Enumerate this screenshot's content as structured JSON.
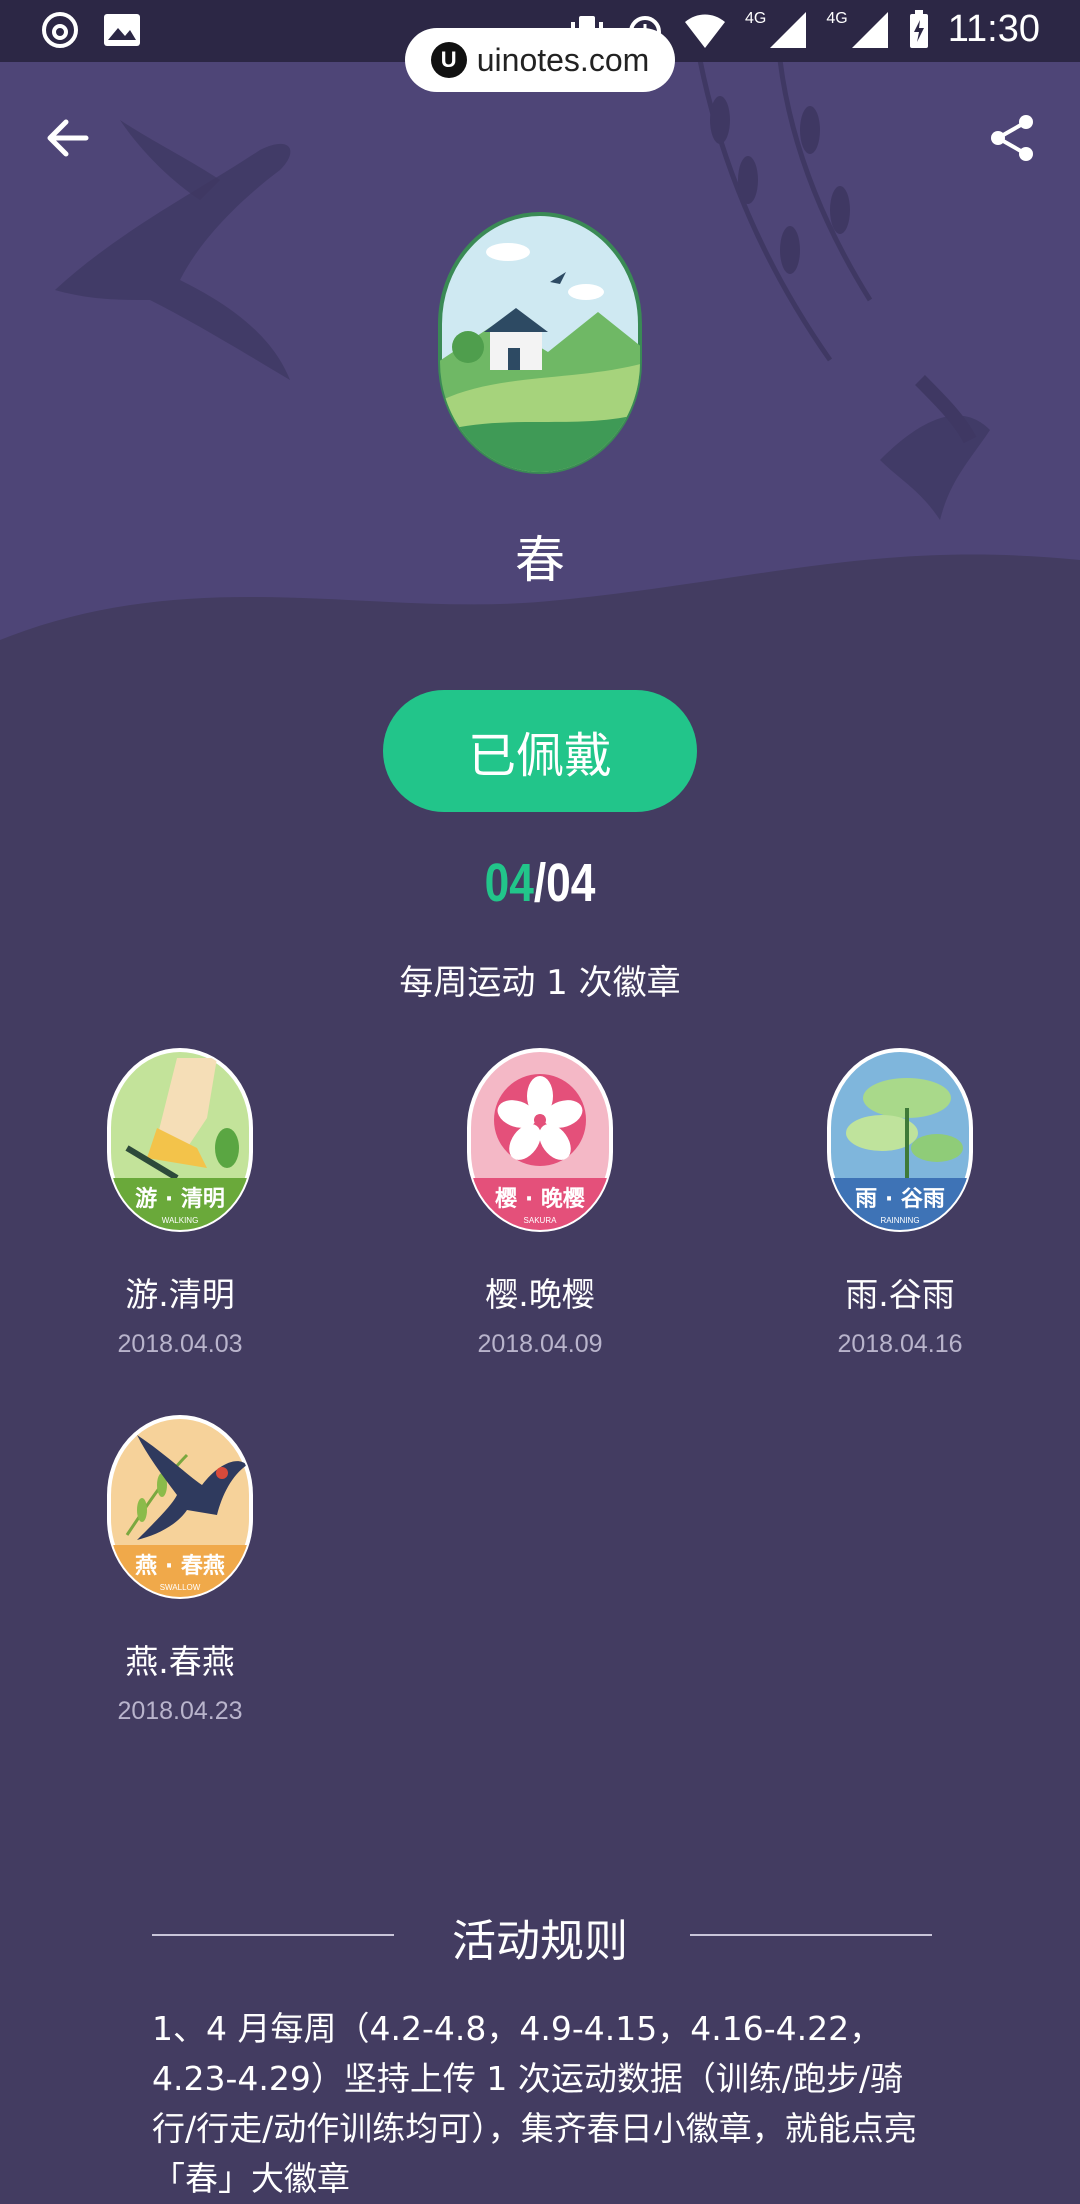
{
  "status_bar": {
    "time": "11:30",
    "network_1": "4G",
    "network_2": "4G"
  },
  "watermark": {
    "text": "uinotes.com",
    "logo": "U"
  },
  "header": {
    "back_icon": "arrow-left-icon",
    "share_icon": "share-icon"
  },
  "badge": {
    "title": "春",
    "status_button": "已佩戴"
  },
  "progress": {
    "current": "04",
    "separator": "/",
    "total": "04"
  },
  "subtitle": "每周运动 1 次徽章",
  "badges": [
    {
      "name": "游.清明",
      "date": "2018.04.03",
      "banner": "游 · 清明",
      "caption": "WALKING",
      "color": "#6aa93a"
    },
    {
      "name": "樱.晚樱",
      "date": "2018.04.09",
      "banner": "樱 · 晚樱",
      "caption": "SAKURA",
      "color": "#e4507a"
    },
    {
      "name": "雨.谷雨",
      "date": "2018.04.16",
      "banner": "雨 · 谷雨",
      "caption": "RAINNING",
      "color": "#3e73b6"
    },
    {
      "name": "燕.春燕",
      "date": "2018.04.23",
      "banner": "燕 · 春燕",
      "caption": "SWALLOW",
      "color": "#f0a94a"
    }
  ],
  "rules": {
    "title": "活动规则",
    "text": "1、4 月每周（4.2-4.8，4.9-4.15，4.16-4.22，4.23-4.29）坚持上传 1 次运动数据（训练/跑步/骑行/行走/动作训练均可），集齐春日小徽章，就能点亮「春」大徽章"
  }
}
